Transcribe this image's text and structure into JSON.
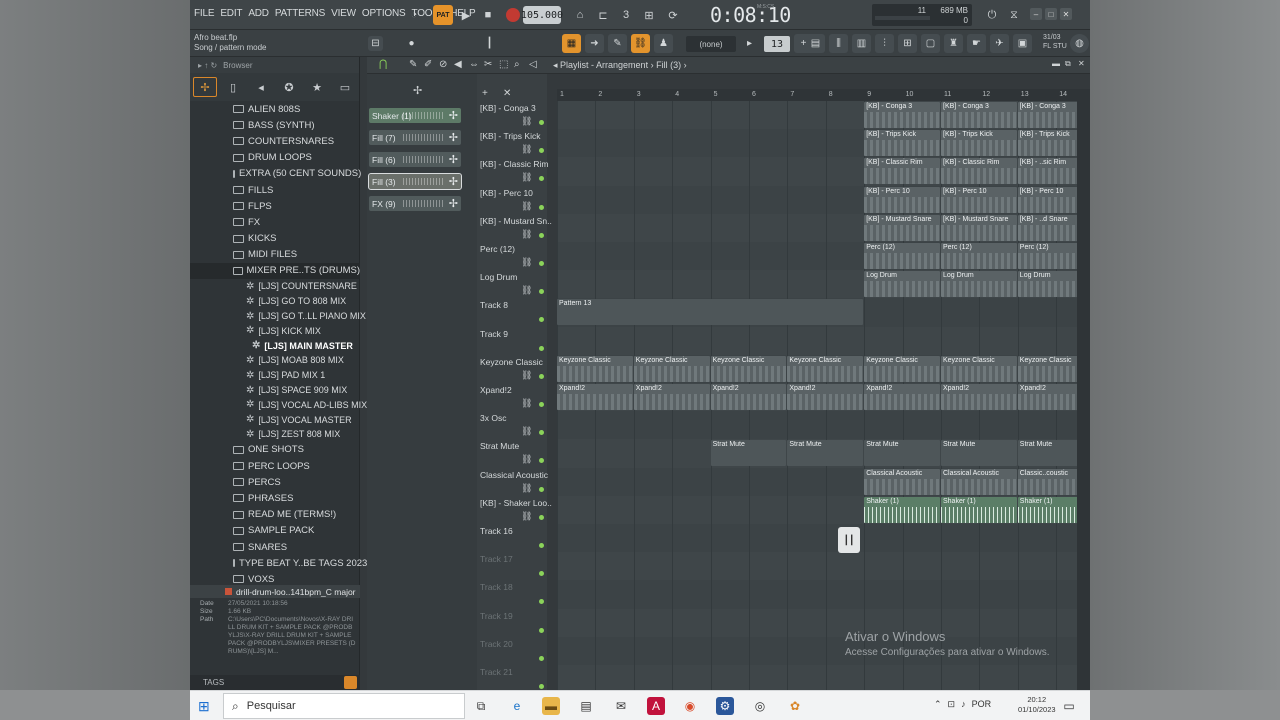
{
  "menu": [
    "FILE",
    "EDIT",
    "ADD",
    "PATTERNS",
    "VIEW",
    "OPTIONS",
    "TOOLS",
    "HELP"
  ],
  "transport": {
    "pat_label": "PAT",
    "tempo": "105.000",
    "time": "0:08:10",
    "time_unit": "M:S:CS"
  },
  "cpu": {
    "voices": "11",
    "memory": "689 MB",
    "zero": "0"
  },
  "hint": {
    "file": "Afro beat.flp",
    "mode": "Song / pattern mode"
  },
  "toolbar2": {
    "pattern_select": "(none)",
    "step": "13",
    "date": "31/03",
    "brand": "FL STU"
  },
  "browser": {
    "title": "Browser",
    "items": [
      {
        "label": "ALIEN 808S",
        "type": "folder"
      },
      {
        "label": "BASS (SYNTH)",
        "type": "folder"
      },
      {
        "label": "COUNTERSNARES",
        "type": "folder"
      },
      {
        "label": "DRUM LOOPS",
        "type": "folder"
      },
      {
        "label": "EXTRA (50 CENT SOUNDS)",
        "type": "folder"
      },
      {
        "label": "FILLS",
        "type": "folder"
      },
      {
        "label": "FLPS",
        "type": "folder"
      },
      {
        "label": "FX",
        "type": "folder"
      },
      {
        "label": "KICKS",
        "type": "folder"
      },
      {
        "label": "MIDI FILES",
        "type": "folder"
      },
      {
        "label": "MIXER PRE..TS (DRUMS)",
        "type": "folder-open"
      }
    ],
    "sub_items": [
      {
        "label": "[LJS] COUNTERSNARE"
      },
      {
        "label": "[LJS] GO TO 808 MIX"
      },
      {
        "label": "[LJS] GO T..LL PIANO MIX"
      },
      {
        "label": "[LJS] KICK MIX"
      },
      {
        "label": "[LJS] MAIN MASTER"
      },
      {
        "label": "[LJS] MOAB 808 MIX"
      },
      {
        "label": "[LJS] PAD MIX 1"
      },
      {
        "label": "[LJS] SPACE 909 MIX"
      },
      {
        "label": "[LJS] VOCAL AD-LIBS MIX"
      },
      {
        "label": "[LJS] VOCAL MASTER"
      },
      {
        "label": "[LJS] ZEST 808 MIX"
      }
    ],
    "items_after": [
      {
        "label": "ONE SHOTS"
      },
      {
        "label": "PERC LOOPS"
      },
      {
        "label": "PERCS"
      },
      {
        "label": "PHRASES"
      },
      {
        "label": "READ ME (TERMS!)"
      },
      {
        "label": "SAMPLE PACK"
      },
      {
        "label": "SNARES"
      },
      {
        "label": "TYPE BEAT Y..BE TAGS 2023"
      },
      {
        "label": "VOXS"
      }
    ],
    "selected_file": "drill-drum-loo..141bpm_C major",
    "meta": {
      "date_label": "Date",
      "date": "27/05/2021 10:18:56",
      "size_label": "Size",
      "size": "1.66 KB",
      "path_label": "Path",
      "path": "C:\\Users\\PC\\Documents\\Novos\\X-RAY DRILL DRUM KIT + SAMPLE PACK @PRODBYLJS\\X-RAY DRILL DRUM KIT + SAMPLE PACK @PRODBYLJS\\MIXER PRESETS (DRUMS)\\[LJS] M..."
    },
    "tags_label": "TAGS"
  },
  "playlist": {
    "title": "Playlist - Arrangement",
    "pattern": "Fill (3)",
    "picker": [
      {
        "label": "Shaker (1)",
        "style": "green"
      },
      {
        "label": "Fill (7)",
        "style": "gray"
      },
      {
        "label": "Fill (6)",
        "style": "gray"
      },
      {
        "label": "Fill (3)",
        "style": "selected"
      },
      {
        "label": "FX (9)",
        "style": "gray"
      }
    ],
    "ruler": [
      "1",
      "2",
      "3",
      "4",
      "5",
      "6",
      "7",
      "8",
      "9",
      "10",
      "11",
      "12",
      "13",
      "14"
    ],
    "tracks": [
      {
        "name": "[KB] - Conga 3"
      },
      {
        "name": "[KB] - Trips Kick"
      },
      {
        "name": "[KB] - Classic Rim"
      },
      {
        "name": "[KB] - Perc 10"
      },
      {
        "name": "[KB] - Mustard Sn.."
      },
      {
        "name": "Perc (12)"
      },
      {
        "name": "Log Drum"
      },
      {
        "name": "Track 8"
      },
      {
        "name": "Track 9"
      },
      {
        "name": "Keyzone Classic"
      },
      {
        "name": "Xpand!2"
      },
      {
        "name": "3x Osc"
      },
      {
        "name": "Strat Mute"
      },
      {
        "name": "Classical Acoustic"
      },
      {
        "name": "[KB] - Shaker Loo.."
      },
      {
        "name": "Track 16"
      },
      {
        "name": "Track 17"
      },
      {
        "name": "Track 18"
      },
      {
        "name": "Track 19"
      },
      {
        "name": "Track 20"
      },
      {
        "name": "Track 21"
      }
    ],
    "clip_labels": {
      "conga": "[KB] - Conga 3",
      "trips": "[KB] - Trips Kick",
      "rim": "[KB] - Classic Rim",
      "rim_short": "[KB] - ..sic Rim",
      "perc10": "[KB] - Perc 10",
      "mustard": "[KB] - Mustard Snare",
      "mustard_short": "[KB] - ..d Snare",
      "perc12": "Perc (12)",
      "logdrum": "Log Drum",
      "pattern13": "Pattern 13",
      "keyzone": "Keyzone Classic",
      "xpand": "Xpand!2",
      "strat": "Strat Mute",
      "classical": "Classical Acoustic",
      "classical_short": "Classic..coustic",
      "shaker": "Shaker (1)"
    }
  },
  "watermark": {
    "line1": "Ativar o Windows",
    "line2": "Acesse Configurações para ativar o Windows."
  },
  "taskbar": {
    "search": "Pesquisar",
    "lang": "POR",
    "time": "20:12",
    "date": "01/10/2023"
  },
  "colors": {
    "accent": "#e3942d",
    "clip_green": "#5b7e67",
    "clip_gray": "#5a6265"
  }
}
